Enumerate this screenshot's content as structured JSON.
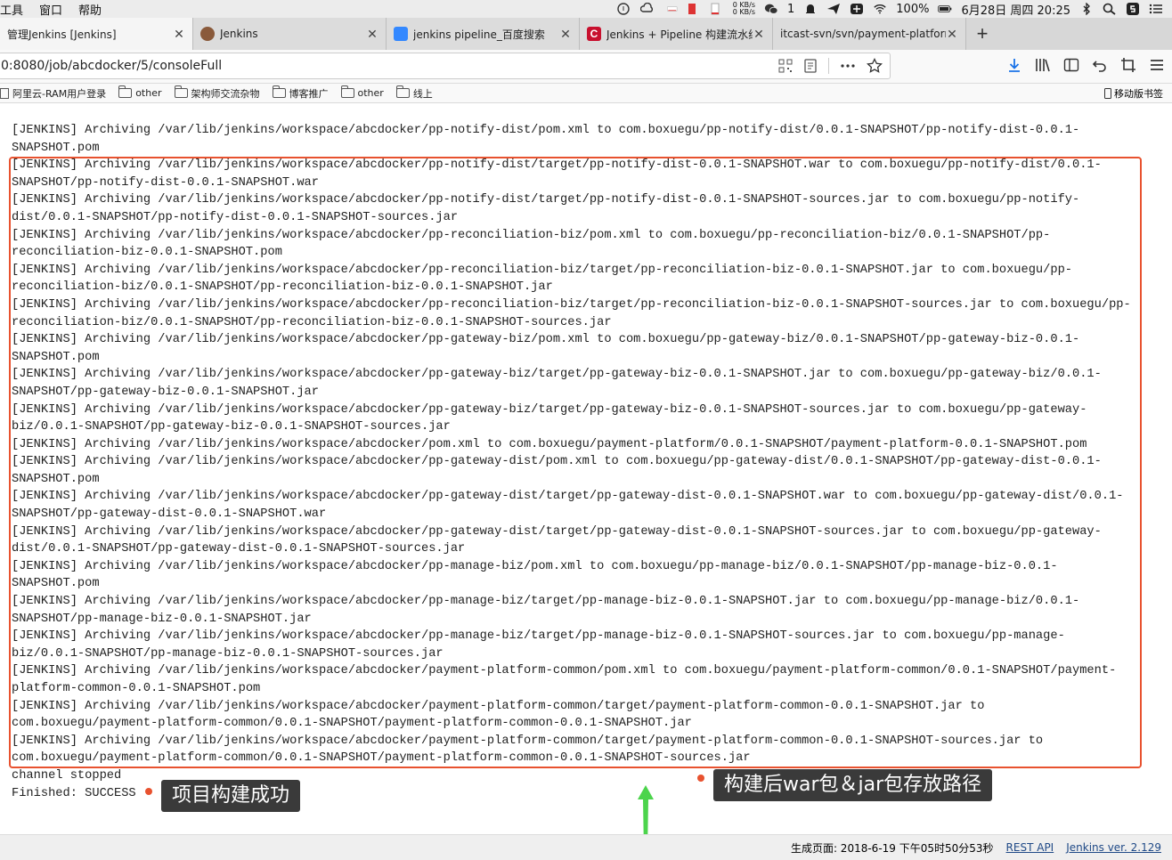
{
  "menubar": {
    "menus": [
      "工具",
      "窗口",
      "帮助"
    ],
    "net_up": "0 KB/s",
    "net_down": "0 KB/s",
    "wechat_count": "1",
    "battery": "100%",
    "date": "6月28日 周四 20:25"
  },
  "tabs": [
    {
      "title": "管理Jenkins [Jenkins]",
      "fav_color": "#d0d0d0"
    },
    {
      "title": "Jenkins",
      "fav_color": "#8a5a3b"
    },
    {
      "title": "jenkins pipeline_百度搜索",
      "fav_color": "#3388ff"
    },
    {
      "title": "Jenkins + Pipeline 构建流水线发",
      "fav_color": "#c8102e"
    },
    {
      "title": "itcast-svn/svn/payment-platform/c",
      "fav_color": ""
    }
  ],
  "address": {
    "url": "0:8080/job/abcdocker/5/consoleFull"
  },
  "bookmarks": [
    {
      "label": "阿里云-RAM用户登录",
      "type": "page"
    },
    {
      "label": "other",
      "type": "folder"
    },
    {
      "label": "架构师交流杂物",
      "type": "folder"
    },
    {
      "label": "博客推广",
      "type": "folder"
    },
    {
      "label": "other",
      "type": "folder"
    },
    {
      "label": "线上",
      "type": "folder"
    }
  ],
  "mobile_bookmarks": "移动版书签",
  "console": {
    "lines": [
      "[JENKINS] Archiving /var/lib/jenkins/workspace/abcdocker/pp-notify-dist/pom.xml to com.boxuegu/pp-notify-dist/0.0.1-SNAPSHOT/pp-notify-dist-0.0.1-",
      "SNAPSHOT.pom",
      "[JENKINS] Archiving /var/lib/jenkins/workspace/abcdocker/pp-notify-dist/target/pp-notify-dist-0.0.1-SNAPSHOT.war to com.boxuegu/pp-notify-dist/0.0.1-",
      "SNAPSHOT/pp-notify-dist-0.0.1-SNAPSHOT.war",
      "[JENKINS] Archiving /var/lib/jenkins/workspace/abcdocker/pp-notify-dist/target/pp-notify-dist-0.0.1-SNAPSHOT-sources.jar to com.boxuegu/pp-notify-",
      "dist/0.0.1-SNAPSHOT/pp-notify-dist-0.0.1-SNAPSHOT-sources.jar",
      "[JENKINS] Archiving /var/lib/jenkins/workspace/abcdocker/pp-reconciliation-biz/pom.xml to com.boxuegu/pp-reconciliation-biz/0.0.1-SNAPSHOT/pp-",
      "reconciliation-biz-0.0.1-SNAPSHOT.pom",
      "[JENKINS] Archiving /var/lib/jenkins/workspace/abcdocker/pp-reconciliation-biz/target/pp-reconciliation-biz-0.0.1-SNAPSHOT.jar to com.boxuegu/pp-",
      "reconciliation-biz/0.0.1-SNAPSHOT/pp-reconciliation-biz-0.0.1-SNAPSHOT.jar",
      "[JENKINS] Archiving /var/lib/jenkins/workspace/abcdocker/pp-reconciliation-biz/target/pp-reconciliation-biz-0.0.1-SNAPSHOT-sources.jar to com.boxuegu/pp-",
      "reconciliation-biz/0.0.1-SNAPSHOT/pp-reconciliation-biz-0.0.1-SNAPSHOT-sources.jar",
      "[JENKINS] Archiving /var/lib/jenkins/workspace/abcdocker/pp-gateway-biz/pom.xml to com.boxuegu/pp-gateway-biz/0.0.1-SNAPSHOT/pp-gateway-biz-0.0.1-",
      "SNAPSHOT.pom",
      "[JENKINS] Archiving /var/lib/jenkins/workspace/abcdocker/pp-gateway-biz/target/pp-gateway-biz-0.0.1-SNAPSHOT.jar to com.boxuegu/pp-gateway-biz/0.0.1-",
      "SNAPSHOT/pp-gateway-biz-0.0.1-SNAPSHOT.jar",
      "[JENKINS] Archiving /var/lib/jenkins/workspace/abcdocker/pp-gateway-biz/target/pp-gateway-biz-0.0.1-SNAPSHOT-sources.jar to com.boxuegu/pp-gateway-",
      "biz/0.0.1-SNAPSHOT/pp-gateway-biz-0.0.1-SNAPSHOT-sources.jar",
      "[JENKINS] Archiving /var/lib/jenkins/workspace/abcdocker/pom.xml to com.boxuegu/payment-platform/0.0.1-SNAPSHOT/payment-platform-0.0.1-SNAPSHOT.pom",
      "[JENKINS] Archiving /var/lib/jenkins/workspace/abcdocker/pp-gateway-dist/pom.xml to com.boxuegu/pp-gateway-dist/0.0.1-SNAPSHOT/pp-gateway-dist-0.0.1-",
      "SNAPSHOT.pom",
      "[JENKINS] Archiving /var/lib/jenkins/workspace/abcdocker/pp-gateway-dist/target/pp-gateway-dist-0.0.1-SNAPSHOT.war to com.boxuegu/pp-gateway-dist/0.0.1-",
      "SNAPSHOT/pp-gateway-dist-0.0.1-SNAPSHOT.war",
      "[JENKINS] Archiving /var/lib/jenkins/workspace/abcdocker/pp-gateway-dist/target/pp-gateway-dist-0.0.1-SNAPSHOT-sources.jar to com.boxuegu/pp-gateway-",
      "dist/0.0.1-SNAPSHOT/pp-gateway-dist-0.0.1-SNAPSHOT-sources.jar",
      "[JENKINS] Archiving /var/lib/jenkins/workspace/abcdocker/pp-manage-biz/pom.xml to com.boxuegu/pp-manage-biz/0.0.1-SNAPSHOT/pp-manage-biz-0.0.1-",
      "SNAPSHOT.pom",
      "[JENKINS] Archiving /var/lib/jenkins/workspace/abcdocker/pp-manage-biz/target/pp-manage-biz-0.0.1-SNAPSHOT.jar to com.boxuegu/pp-manage-biz/0.0.1-",
      "SNAPSHOT/pp-manage-biz-0.0.1-SNAPSHOT.jar",
      "[JENKINS] Archiving /var/lib/jenkins/workspace/abcdocker/pp-manage-biz/target/pp-manage-biz-0.0.1-SNAPSHOT-sources.jar to com.boxuegu/pp-manage-",
      "biz/0.0.1-SNAPSHOT/pp-manage-biz-0.0.1-SNAPSHOT-sources.jar",
      "[JENKINS] Archiving /var/lib/jenkins/workspace/abcdocker/payment-platform-common/pom.xml to com.boxuegu/payment-platform-common/0.0.1-SNAPSHOT/payment-",
      "platform-common-0.0.1-SNAPSHOT.pom",
      "[JENKINS] Archiving /var/lib/jenkins/workspace/abcdocker/payment-platform-common/target/payment-platform-common-0.0.1-SNAPSHOT.jar to",
      "com.boxuegu/payment-platform-common/0.0.1-SNAPSHOT/payment-platform-common-0.0.1-SNAPSHOT.jar",
      "[JENKINS] Archiving /var/lib/jenkins/workspace/abcdocker/payment-platform-common/target/payment-platform-common-0.0.1-SNAPSHOT-sources.jar to",
      "com.boxuegu/payment-platform-common/0.0.1-SNAPSHOT/payment-platform-common-0.0.1-SNAPSHOT-sources.jar",
      "channel stopped",
      "Finished: SUCCESS"
    ]
  },
  "annotations": {
    "build_success": "项目构建成功",
    "artifact_path": "构建后war包＆jar包存放路径",
    "accent_color": "#e8522f"
  },
  "footer": {
    "generated": "生成页面: 2018-6-19 下午05时50分53秒",
    "rest_api": "REST API",
    "version": "Jenkins ver. 2.129"
  }
}
